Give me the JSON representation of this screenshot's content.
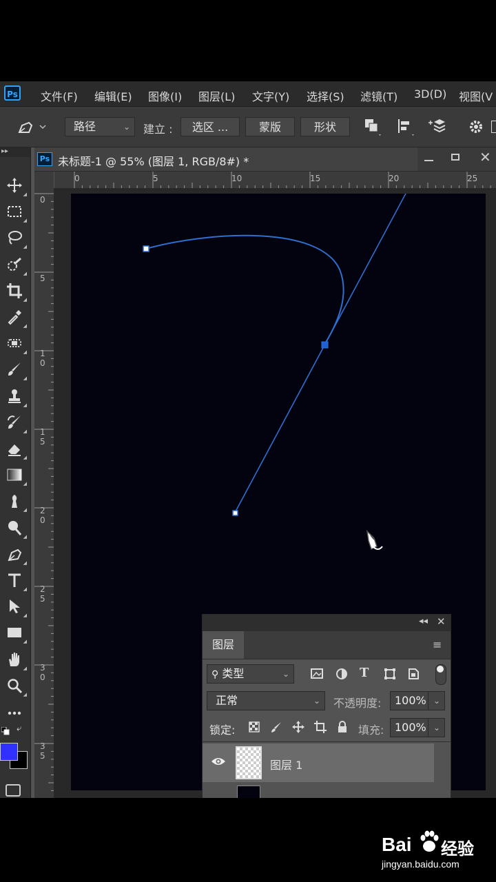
{
  "app": {
    "logo": "Ps"
  },
  "menu": [
    "文件(F)",
    "编辑(E)",
    "图像(I)",
    "图层(L)",
    "文字(Y)",
    "选择(S)",
    "滤镜(T)",
    "3D(D)",
    "视图(V"
  ],
  "options": {
    "mode": "路径",
    "build_label": "建立 :",
    "selection_btn": "选区 ...",
    "mask_btn": "蒙版",
    "shape_btn": "形状"
  },
  "document": {
    "tab_logo": "Ps",
    "title": "未标题-1 @ 55% (图层 1, RGB/8#) *"
  },
  "rulers": {
    "top": [
      "0",
      "5",
      "10",
      "15",
      "20",
      "25"
    ],
    "left": [
      [
        "0"
      ],
      [
        "5"
      ],
      [
        "1",
        "0"
      ],
      [
        "1",
        "5"
      ],
      [
        "2",
        "0"
      ],
      [
        "2",
        "5"
      ],
      [
        "3",
        "0"
      ],
      [
        "3",
        "5"
      ]
    ]
  },
  "colors": {
    "foreground": "#3131ff",
    "background": "#000000",
    "path": "#2f6fcf",
    "canvas": "#03030f"
  },
  "toolbar_icons": [
    "move-icon",
    "marquee-icon",
    "lasso-icon",
    "quick-select-icon",
    "crop-icon",
    "eyedropper-icon",
    "healing-icon",
    "brush-icon",
    "stamp-icon",
    "history-brush-icon",
    "eraser-icon",
    "gradient-icon",
    "smudge-icon",
    "dodge-icon",
    "pen-icon",
    "type-icon",
    "path-select-icon",
    "rectangle-icon",
    "hand-icon",
    "zoom-icon",
    "more-icon"
  ],
  "layers_panel": {
    "tab": "图层",
    "filter_kind": "类型",
    "blend_mode": "正常",
    "opacity_label": "不透明度:",
    "opacity_value": "100%",
    "lock_label": "锁定:",
    "fill_label": "填充:",
    "fill_value": "100%",
    "layers": [
      {
        "name": "图层 1",
        "visible": true
      }
    ]
  },
  "watermark": {
    "brand": "Bai",
    "brand_cn": "经验",
    "url": "jingyan.baidu.com"
  }
}
